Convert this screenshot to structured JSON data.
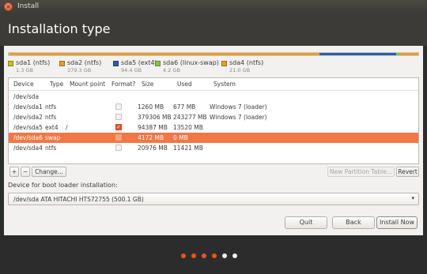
{
  "window": {
    "title": "Install"
  },
  "header": {
    "title": "Installation type"
  },
  "colors": {
    "accent": "#e95420",
    "selected_row": "#f07746"
  },
  "partition_bar": [
    {
      "name": "sda1 (ntfs)",
      "size": "1.3 GB",
      "color": "#c8c01b",
      "fraction": 0.003
    },
    {
      "name": "sda2 (ntfs)",
      "size": "379.3 GB",
      "color": "#e99d2a",
      "fraction": 0.755
    },
    {
      "name": "sda5 (ext4)",
      "size": "94.4 GB",
      "color": "#2c5da8",
      "fraction": 0.188
    },
    {
      "name": "sda6 (linux-swap)",
      "size": "4.2 GB",
      "color": "#8bc34a",
      "fraction": 0.009
    },
    {
      "name": "sda4 (ntfs)",
      "size": "21.0 GB",
      "color": "#e99d2a",
      "fraction": 0.045
    }
  ],
  "table": {
    "headers": {
      "device": "Device",
      "type": "Type",
      "mount": "Mount point",
      "format": "Format?",
      "size": "Size",
      "used": "Used",
      "system": "System"
    },
    "group": "/dev/sda",
    "rows": [
      {
        "device": "/dev/sda1",
        "type": "ntfs",
        "mount": "",
        "format": false,
        "size": "1260 MB",
        "used": "677 MB",
        "system": "Windows 7 (loader)"
      },
      {
        "device": "/dev/sda2",
        "type": "ntfs",
        "mount": "",
        "format": false,
        "size": "379306 MB",
        "used": "243277 MB",
        "system": "Windows 7 (loader)"
      },
      {
        "device": "/dev/sda5",
        "type": "ext4",
        "mount": "/",
        "format": true,
        "size": "94387 MB",
        "used": "13520 MB",
        "system": ""
      },
      {
        "device": "/dev/sda6",
        "type": "swap",
        "mount": "",
        "format": false,
        "size": "4172 MB",
        "used": "0 MB",
        "system": "",
        "selected": true
      },
      {
        "device": "/dev/sda4",
        "type": "ntfs",
        "mount": "",
        "format": false,
        "size": "20976 MB",
        "used": "11421 MB",
        "system": ""
      }
    ]
  },
  "toolbar": {
    "add": "+",
    "remove": "−",
    "change": "Change...",
    "new_table": "New Partition Table...",
    "revert": "Revert"
  },
  "boot": {
    "label": "Device for boot loader installation:",
    "value": "/dev/sda   ATA HITACHI HTS72755 (500.1 GB)",
    "arrow": "▾"
  },
  "buttons": {
    "quit": "Quit",
    "back": "Back",
    "install": "Install Now"
  },
  "progress": {
    "total_steps": 6,
    "completed_steps": 3
  }
}
